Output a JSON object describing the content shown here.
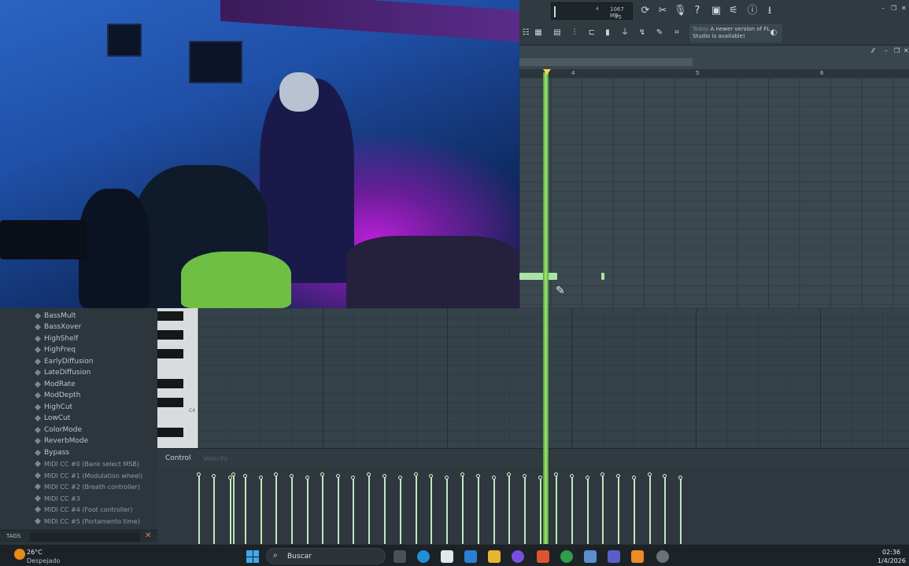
{
  "fl_toolbar": {
    "cpu": "4",
    "memory": "1067 MB",
    "polyphony": "75",
    "news": {
      "when": "Today",
      "message": "A newer version of FL Studio is available!"
    },
    "icons": [
      "restart-icon",
      "tools-icon",
      "mic-icon",
      "help-icon",
      "save-icon",
      "plugin-icon",
      "info-icon",
      "download-icon"
    ]
  },
  "playlist": {
    "ruler_marks": [
      "4",
      "5",
      "6"
    ]
  },
  "browser": {
    "items": [
      "BassMult",
      "BassXover",
      "HighShelf",
      "HighFreq",
      "EarlyDiffusion",
      "LateDiffusion",
      "ModRate",
      "ModDepth",
      "HighCut",
      "LowCut",
      "ColorMode",
      "ReverbMode",
      "Bypass"
    ],
    "midi_items": [
      "MIDI CC #0 (Bank select MSB)",
      "MIDI CC #1 (Modulation wheel)",
      "MIDI CC #2 (Breath controller)",
      "MIDI CC #3",
      "MIDI CC #4 (Foot controller)",
      "MIDI CC #5 (Portamento time)"
    ],
    "tags_label": "TAGS"
  },
  "piano_roll": {
    "key_label": "C4",
    "control_label": "Control",
    "control_ghost": "Velocity"
  },
  "taskbar": {
    "weather_temp": "26°C",
    "weather_desc": "Despejado",
    "search_placeholder": "Buscar",
    "time": "02:36",
    "date": "1/4/2026"
  }
}
